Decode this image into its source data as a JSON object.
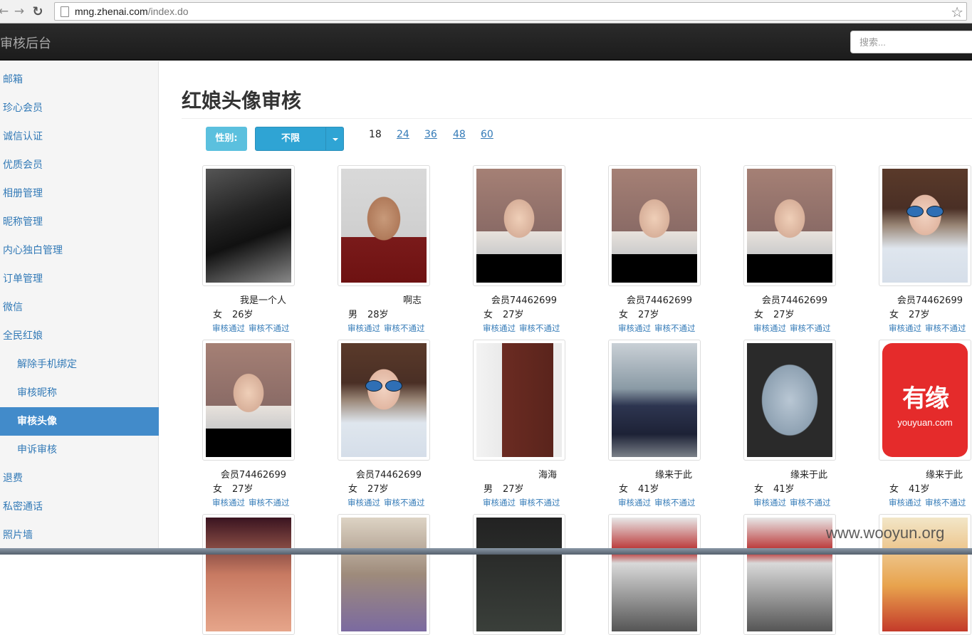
{
  "browser": {
    "url_host": "mng.zhenai.com",
    "url_path": "/index.do"
  },
  "app": {
    "brand": "审核后台",
    "search_placeholder": "搜索..."
  },
  "sidebar": {
    "items": [
      {
        "label": "邮箱"
      },
      {
        "label": "珍心会员"
      },
      {
        "label": "诚信认证"
      },
      {
        "label": "优质会员"
      },
      {
        "label": "相册管理"
      },
      {
        "label": "昵称管理"
      },
      {
        "label": "内心独白管理"
      },
      {
        "label": "订单管理"
      },
      {
        "label": "微信"
      },
      {
        "label": "全民红娘"
      },
      {
        "label": "解除手机绑定"
      },
      {
        "label": "审核昵称"
      },
      {
        "label": "审核头像"
      },
      {
        "label": "申诉审核"
      },
      {
        "label": "退费"
      },
      {
        "label": "私密通话"
      },
      {
        "label": "照片墙"
      }
    ],
    "active": "审核头像"
  },
  "main": {
    "title": "红娘头像审核",
    "filter": {
      "gender_label": "性别:",
      "gender_value": "不限"
    },
    "page_sizes": [
      "18",
      "24",
      "36",
      "48",
      "60"
    ],
    "current_page_size": "18",
    "approve_label": "审核通过",
    "reject_label": "审核不通过",
    "cards": [
      {
        "name": "我是一个人",
        "gender": "女",
        "age": "26岁",
        "photo": "pc"
      },
      {
        "name": "啊志",
        "gender": "男",
        "age": "28岁",
        "photo": "man"
      },
      {
        "name": "会员74462699",
        "gender": "女",
        "age": "27岁",
        "photo": "woman"
      },
      {
        "name": "会员74462699",
        "gender": "女",
        "age": "27岁",
        "photo": "woman"
      },
      {
        "name": "会员74462699",
        "gender": "女",
        "age": "27岁",
        "photo": "woman"
      },
      {
        "name": "会员74462699",
        "gender": "女",
        "age": "27岁",
        "photo": "glasses"
      },
      {
        "name": "会员74462699",
        "gender": "女",
        "age": "27岁",
        "photo": "woman"
      },
      {
        "name": "会员74462699",
        "gender": "女",
        "age": "27岁",
        "photo": "glasses"
      },
      {
        "name": "海海",
        "gender": "男",
        "age": "27岁",
        "photo": "door"
      },
      {
        "name": "缘来于此",
        "gender": "女",
        "age": "41岁",
        "photo": "salon"
      },
      {
        "name": "缘来于此",
        "gender": "女",
        "age": "41岁",
        "photo": "screen"
      },
      {
        "name": "缘来于此",
        "gender": "女",
        "age": "41岁",
        "photo": "logo"
      }
    ],
    "logo_text": "有缘",
    "logo_sub": "youyuan.com"
  },
  "watermark": "www.wooyun.org"
}
